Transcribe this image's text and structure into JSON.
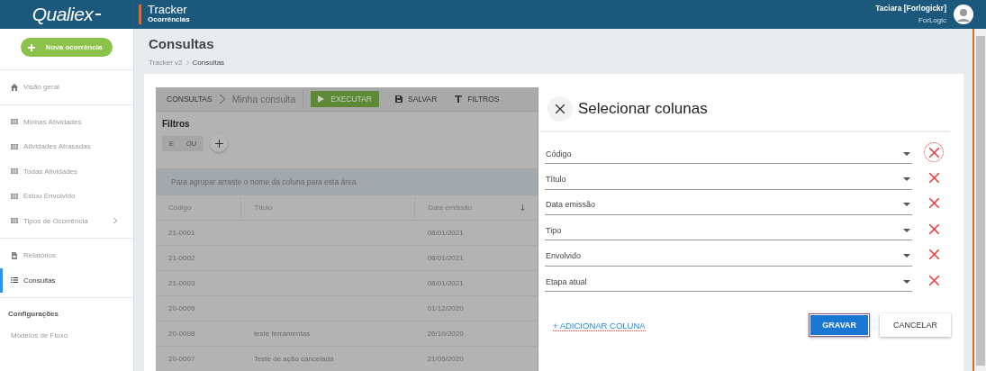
{
  "header": {
    "logo": "Qualiex",
    "module_title": "Tracker",
    "module_subtitle": "Ocorrências",
    "user_name": "Taciara [Forlogickr]",
    "company": "ForLogic"
  },
  "sidebar": {
    "new_button": "Nova ocorrência",
    "groups": [
      {
        "items": [
          {
            "label": "Visão geral",
            "selected": false,
            "expandable": false
          }
        ]
      },
      {
        "items": [
          {
            "label": "Minhas Atividades",
            "selected": false,
            "expandable": false
          },
          {
            "label": "Atividades Atrasadas",
            "selected": false,
            "expandable": false
          },
          {
            "label": "Todas Atividades",
            "selected": false,
            "expandable": false
          },
          {
            "label": "Estou Envolvido",
            "selected": false,
            "expandable": false
          },
          {
            "label": "Tipos de Ocorrência",
            "selected": false,
            "expandable": true
          }
        ]
      },
      {
        "items": [
          {
            "label": "Relatórios",
            "selected": false,
            "expandable": false
          },
          {
            "label": "Consultas",
            "selected": true,
            "expandable": false
          }
        ]
      },
      {
        "heading": "Configurações",
        "items": [
          {
            "label": "Modelos de Fluxo",
            "selected": false,
            "expandable": false
          }
        ]
      }
    ]
  },
  "page": {
    "title": "Consultas",
    "breadcrumb": [
      "Tracker v2",
      "Consultas"
    ]
  },
  "query": {
    "toolbar": {
      "root": "CONSULTAS",
      "query_name": "Minha consulta",
      "actions": [
        {
          "label": "EXECUTAR",
          "kind": "primary"
        },
        {
          "label": "SALVAR",
          "kind": "save"
        },
        {
          "label": "FILTROS",
          "kind": "filter"
        }
      ]
    },
    "filters": {
      "title": "Filtros",
      "operators": [
        "E",
        "OU"
      ]
    },
    "group_hint": "Para agrupar arraste o nome da coluna para esta área",
    "table": {
      "columns": [
        {
          "label": "Código",
          "sorted": false
        },
        {
          "label": "Título",
          "sorted": false
        },
        {
          "label": "Data emissão",
          "sorted": true
        }
      ],
      "rows": [
        [
          "21-0001",
          "",
          "08/01/2021"
        ],
        [
          "21-0002",
          "",
          "08/01/2021"
        ],
        [
          "21-0003",
          "",
          "08/01/2021"
        ],
        [
          "20-0009",
          "",
          "01/12/2020"
        ],
        [
          "20-0008",
          "teste ferramentas",
          "26/10/2020"
        ],
        [
          "20-0007",
          "Teste de ação cancelada",
          "21/05/2020"
        ]
      ]
    }
  },
  "dialog": {
    "title": "Selecionar colunas",
    "columns": [
      {
        "value": "Código",
        "focused": true
      },
      {
        "value": "Título",
        "focused": false
      },
      {
        "value": "Data emissão",
        "focused": false
      },
      {
        "value": "Tipo",
        "focused": false
      },
      {
        "value": "Envolvido",
        "focused": false
      },
      {
        "value": "Etapa atual",
        "focused": false
      }
    ],
    "add_link": "+ ADICIONAR COLUNA",
    "buttons": [
      {
        "label": "GRAVAR",
        "kind": "primary",
        "focused": true
      },
      {
        "label": "CANCELAR",
        "kind": "secondary",
        "focused": false
      }
    ]
  }
}
